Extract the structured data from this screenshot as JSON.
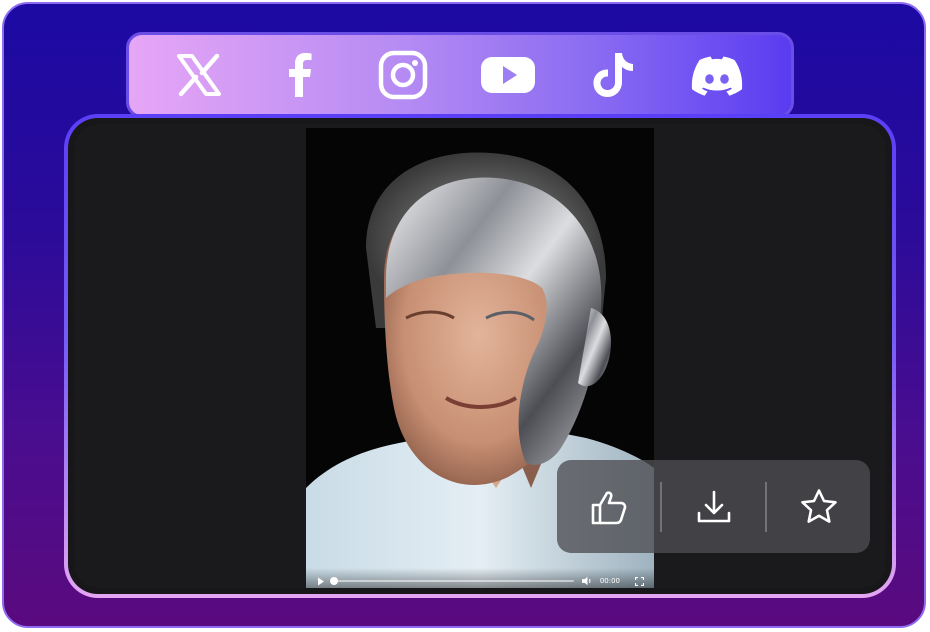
{
  "colors": {
    "frame_gradient": [
      "#1c0aa3",
      "#5a0a7e"
    ],
    "social_bar_gradient": [
      "#e6a6f6",
      "#5a3cf1"
    ],
    "player_border_gradient": [
      "#5a3ff6",
      "#e5a6f2"
    ],
    "icon_fill": "#ffffff"
  },
  "social": {
    "icons": [
      "x-icon",
      "facebook-icon",
      "instagram-icon",
      "youtube-icon",
      "tiktok-icon",
      "discord-icon"
    ]
  },
  "player": {
    "current_time": "00:00",
    "progress": 0.0,
    "controls": [
      "play-icon",
      "volume-icon",
      "fullscreen-icon"
    ]
  },
  "actions": {
    "icons": [
      "thumbs-up-icon",
      "download-icon",
      "star-icon"
    ]
  }
}
